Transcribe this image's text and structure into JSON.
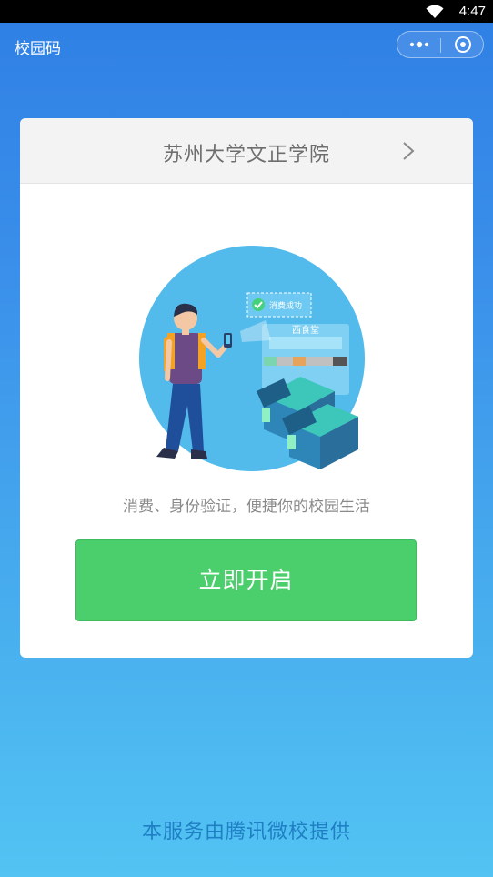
{
  "status_bar": {
    "time": "4:47"
  },
  "header": {
    "title": "校园码"
  },
  "card": {
    "school_name": "苏州大学文正学院",
    "illustration": {
      "success_badge": "消费成功",
      "canteen_sign": "西食堂"
    },
    "tagline": "消费、身份验证，便捷你的校园生活",
    "enable_button_label": "立即开启"
  },
  "footer": {
    "text": "本服务由腾讯微校提供"
  },
  "colors": {
    "button_green": "#4bcf6c",
    "footer_blue": "#1f7fc4",
    "bg_top": "#2f7fe4",
    "bg_bottom": "#52c3f3"
  }
}
